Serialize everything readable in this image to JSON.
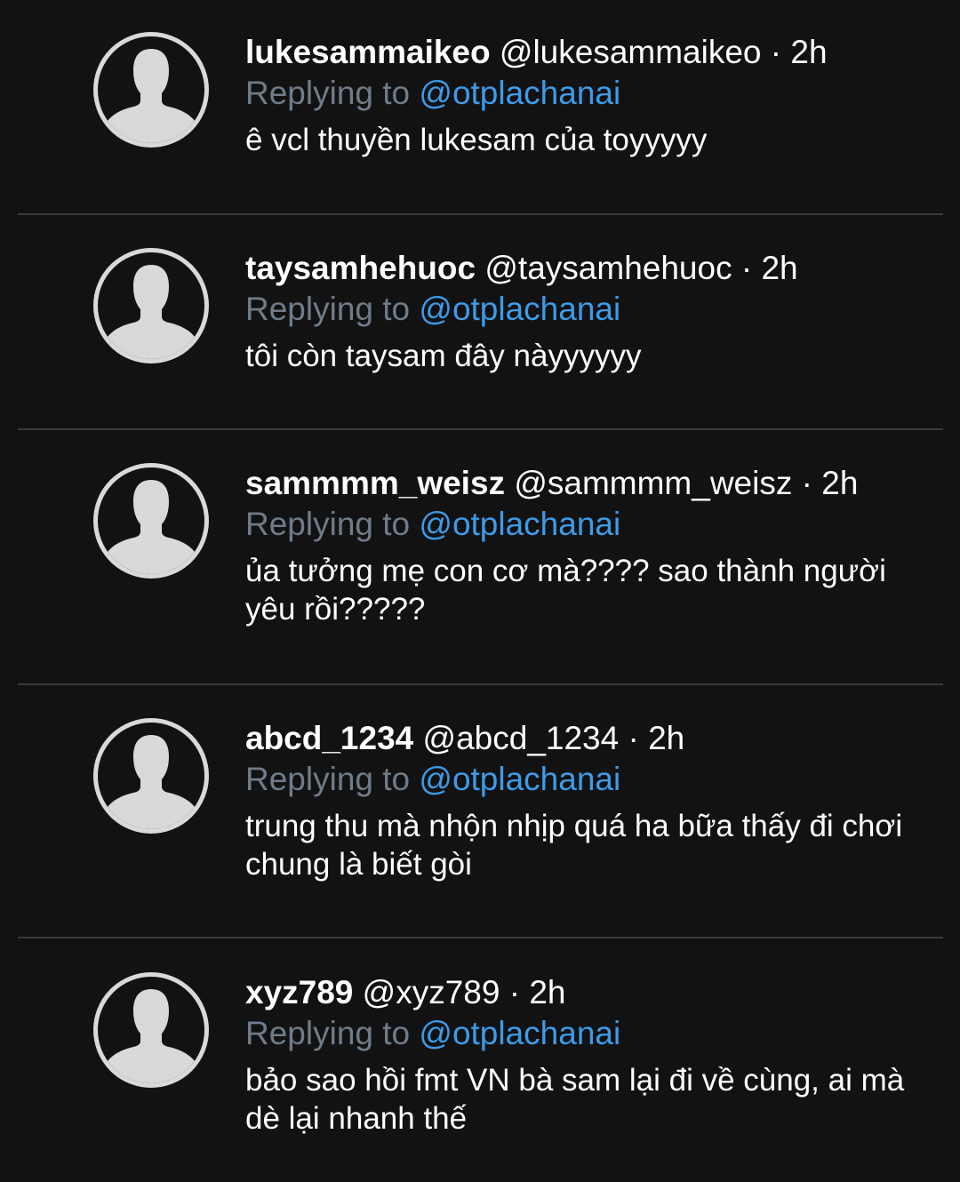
{
  "replies": [
    {
      "display_name": "lukesammaikeo",
      "handle": "@lukesammaikeo",
      "separator": "·",
      "time": "2h",
      "replying_prefix": "Replying to",
      "replying_to": "@otplachanai",
      "text": "ê vcl thuyền lukesam của toyyyyy",
      "avatar_icon": "default-avatar-icon"
    },
    {
      "display_name": "taysamhehuoc",
      "handle": "@taysamhehuoc",
      "separator": "·",
      "time": "2h",
      "replying_prefix": "Replying to",
      "replying_to": "@otplachanai",
      "text": "tôi còn taysam đây nàyyyyyy",
      "avatar_icon": "default-avatar-icon"
    },
    {
      "display_name": "sammmm_weisz",
      "handle": "@sammmm_weisz",
      "separator": "·",
      "time": "2h",
      "replying_prefix": "Replying to",
      "replying_to": "@otplachanai",
      "text": "ủa tưởng mẹ con cơ mà???? sao thành người yêu rồi?????",
      "avatar_icon": "default-avatar-icon"
    },
    {
      "display_name": "abcd_1234",
      "handle": "@abcd_1234",
      "separator": "·",
      "time": "2h",
      "replying_prefix": "Replying to",
      "replying_to": "@otplachanai",
      "text": "trung thu mà nhộn nhịp quá ha bữa thấy đi chơi chung là biết gòi",
      "avatar_icon": "default-avatar-icon"
    },
    {
      "display_name": "xyz789",
      "handle": "@xyz789",
      "separator": "·",
      "time": "2h",
      "replying_prefix": "Replying to",
      "replying_to": "@otplachanai",
      "text": "bảo sao hồi fmt VN bà sam lại đi về cùng, ai mà dè lại nhanh thế",
      "avatar_icon": "default-avatar-icon"
    }
  ],
  "colors": {
    "background": "#121212",
    "divider": "#3a3a3a",
    "muted_text": "#6f7c8a",
    "mention": "#3d9be9",
    "avatar": "#d9d9d9"
  }
}
